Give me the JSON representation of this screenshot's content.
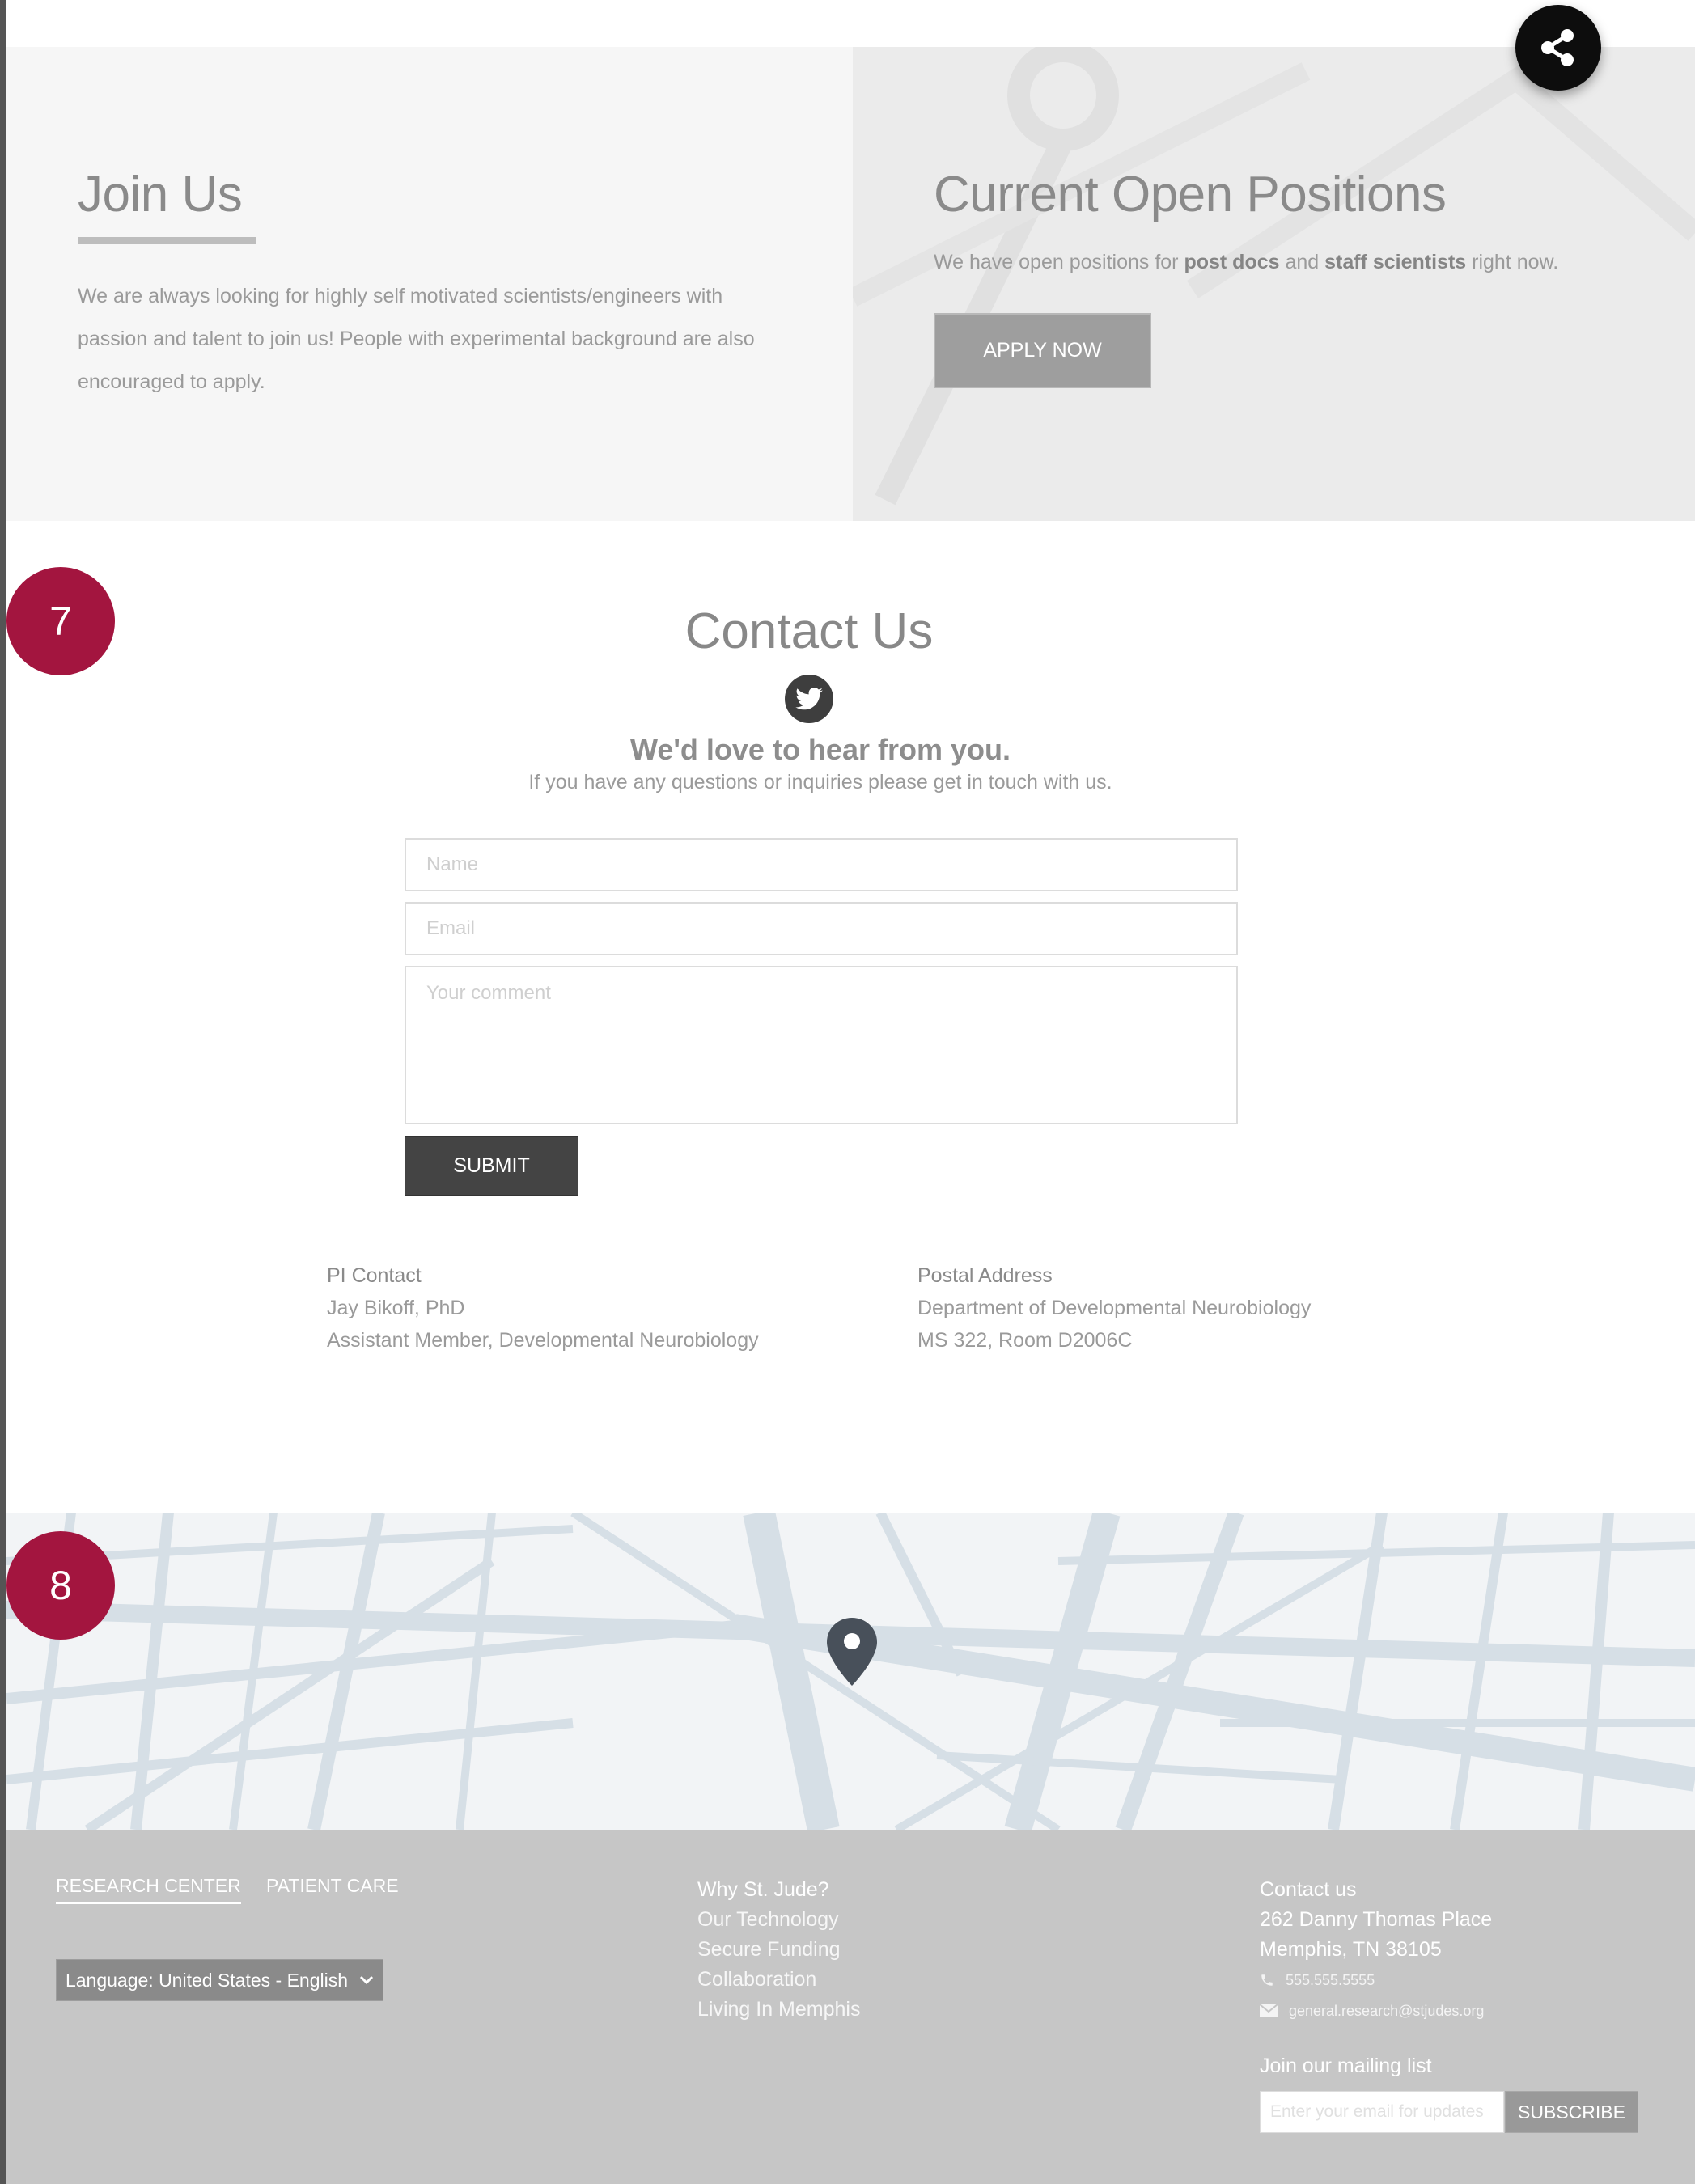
{
  "share": {
    "icon": "share-icon"
  },
  "join": {
    "title": "Join Us",
    "text": "We are always looking for highly self motivated scientists/engineers with passion and talent to join us! People with experimental background are also encouraged to apply."
  },
  "positions": {
    "title": "Current Open Positions",
    "text_before": "We have open positions for ",
    "bold1": "post docs",
    "text_mid": " and ",
    "bold2": "staff scientists",
    "text_after": " right now.",
    "apply_label": "APPLY NOW"
  },
  "markers": {
    "m7": "7",
    "m8": "8"
  },
  "contact": {
    "title": "Contact Us",
    "icon": "twitter-icon",
    "headline": "We'd love to hear from you.",
    "subline": "If you have any questions or inquiries please get in touch with us.",
    "name_placeholder": "Name",
    "email_placeholder": "Email",
    "comment_placeholder": "Your comment",
    "submit_label": "SUBMIT"
  },
  "pi_contact": {
    "heading": "PI Contact",
    "name": "Jay Bikoff, PhD",
    "role": "Assistant Member, Developmental Neurobiology"
  },
  "postal_address": {
    "heading": "Postal Address",
    "line1": "Department of Developmental Neurobiology",
    "line2": "MS 322, Room D2006C"
  },
  "map": {
    "pin_icon": "map-pin-icon"
  },
  "footer": {
    "tabs": [
      "RESEARCH CENTER",
      "PATIENT CARE"
    ],
    "language": "Language: United States - English",
    "why": {
      "title": "Why St. Jude?",
      "links": [
        "Our Technology",
        "Secure Funding",
        "Collaboration",
        "Living In Memphis"
      ]
    },
    "contact": {
      "title": "Contact us",
      "address1": "262 Danny Thomas Place",
      "address2": "Memphis, TN 38105",
      "phone": "555.555.5555",
      "email": "general.research@stjudes.org"
    },
    "mailing": {
      "title": "Join our mailing list",
      "placeholder": "Enter your email for updates",
      "subscribe_label": "SUBSCRIBE"
    }
  },
  "colors": {
    "marker": "#a3153f",
    "footer": "#c6c6c6",
    "submit": "#444444"
  }
}
